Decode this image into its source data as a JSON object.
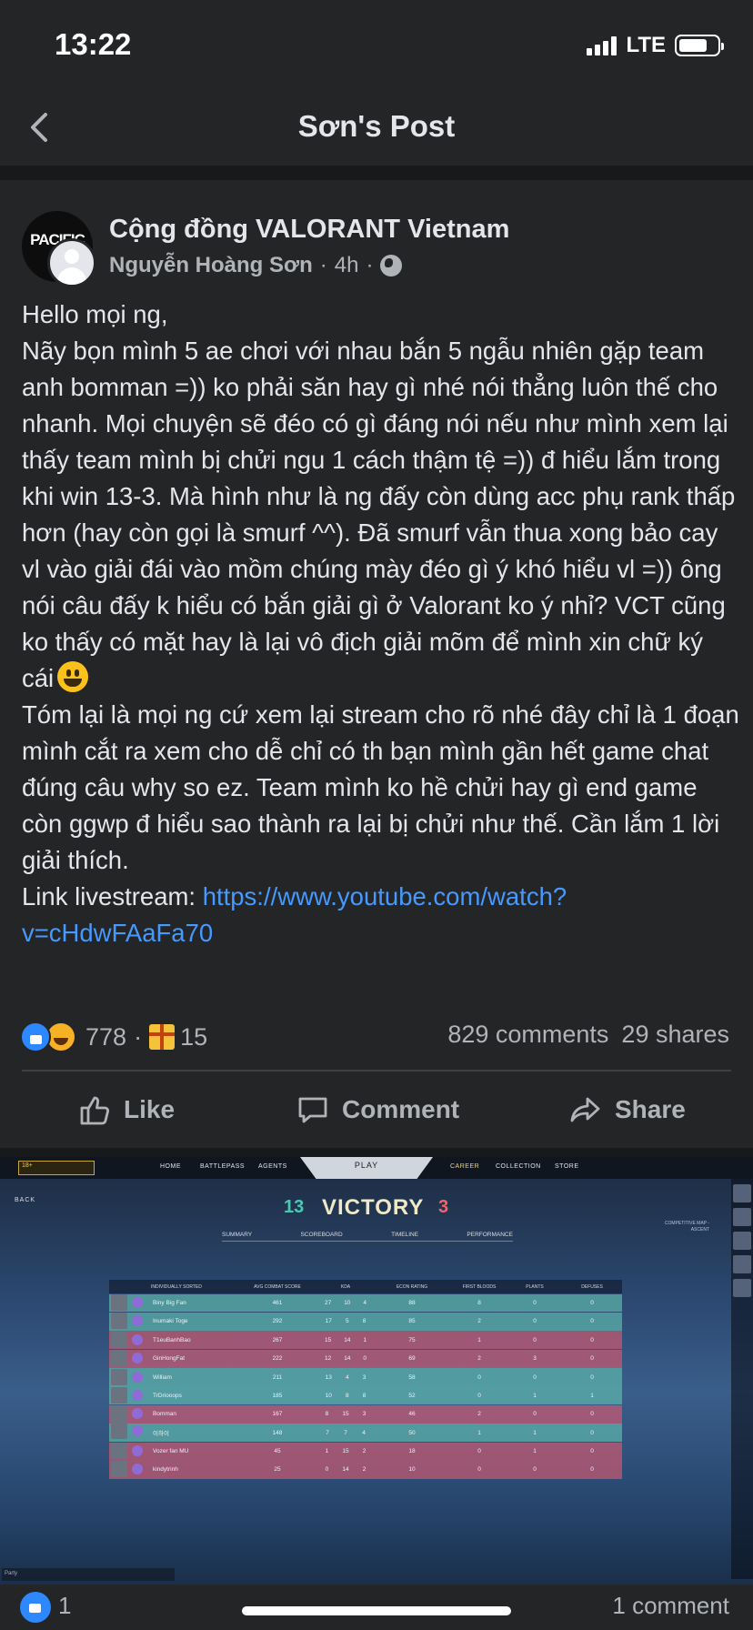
{
  "status_bar": {
    "time": "13:22",
    "network": "LTE"
  },
  "nav": {
    "title": "Sơn's Post"
  },
  "post": {
    "group_name": "Cộng đồng VALORANT Vietnam",
    "group_avatar_text": "PACIFIC",
    "author": "Nguyễn Hoàng Sơn",
    "sep1": "·",
    "time_ago": "4h",
    "sep2": "·",
    "text": {
      "line1": "Hello mọi ng,",
      "para1": "Nãy bọn mình 5 ae chơi với nhau bắn 5 ngẫu nhiên gặp team anh bomman =)) ko phải săn hay gì nhé nói thẳng luôn thế cho nhanh. Mọi chuyện sẽ đéo có gì đáng nói nếu như mình xem lại thấy team mình bị chửi ngu 1 cách thậm tệ =)) đ hiểu lắm trong khi win 13-3. Mà hình như là ng đấy còn dùng acc phụ rank thấp hơn (hay còn gọi là smurf ^^).  Đã smurf vẫn thua xong bảo cay vl vào giải đái vào mồm chúng mày đéo gì ý khó hiểu vl =)) ông nói câu đấy k hiểu có bắn giải gì ở Valorant ko ý nhỉ? VCT cũng ko thấy có mặt hay là lại vô địch giải mõm để mình xin chữ ký cái",
      "para2": "Tóm lại là mọi ng cứ xem lại stream cho rõ nhé đây chỉ là 1 đoạn mình cắt ra xem cho dễ chỉ có th bạn mình gần hết game chat đúng câu why so ez. Team mình ko hề chửi hay gì end game còn ggwp đ hiểu sao thành ra lại bị chửi như thế. Cần lắm 1 lời giải thích.",
      "link_label": "Link livestream: ",
      "link_url": "https://www.youtube.com/watch?v=cHdwFAaFa70"
    },
    "reactions": {
      "count": "778",
      "sep": "·",
      "gifts": "15"
    },
    "comments": "829 comments",
    "shares": "29 shares",
    "actions": {
      "like": "Like",
      "comment": "Comment",
      "share": "Share"
    }
  },
  "game_screenshot": {
    "age_badge": "18+",
    "nav": [
      "HOME",
      "BATTLEPASS",
      "AGENTS",
      "CAREER",
      "COLLECTION",
      "STORE"
    ],
    "play": "PLAY",
    "back": "BACK",
    "score_left": "13",
    "result": "VICTORY",
    "score_right": "3",
    "tabs": [
      "SUMMARY",
      "SCOREBOARD",
      "TIMELINE",
      "PERFORMANCE"
    ],
    "match_info": "COMPETITIVE MAP - ASCENT",
    "table_headers": [
      "INDIVIDUALLY SORTED",
      "AVG COMBAT SCORE",
      "KDA",
      "ECON RATING",
      "FIRST BLOODS",
      "PLANTS",
      "DEFUSES"
    ],
    "rows": [
      {
        "team": "a",
        "name": "Biny Big Fan",
        "acs": "461",
        "k": "27",
        "d": "10",
        "a": "4",
        "econ": "88",
        "fb": "8",
        "plants": "0",
        "defuses": "0"
      },
      {
        "team": "a",
        "name": "Inumaki Toge",
        "acs": "292",
        "k": "17",
        "d": "5",
        "a": "8",
        "econ": "85",
        "fb": "2",
        "plants": "0",
        "defuses": "0"
      },
      {
        "team": "b",
        "name": "T1euBanhBao",
        "acs": "267",
        "k": "15",
        "d": "14",
        "a": "1",
        "econ": "75",
        "fb": "1",
        "plants": "0",
        "defuses": "0"
      },
      {
        "team": "b",
        "name": "GinHongFat",
        "acs": "222",
        "k": "12",
        "d": "14",
        "a": "0",
        "econ": "69",
        "fb": "2",
        "plants": "3",
        "defuses": "0"
      },
      {
        "team": "a",
        "name": "William",
        "acs": "211",
        "k": "13",
        "d": "4",
        "a": "3",
        "econ": "58",
        "fb": "0",
        "plants": "0",
        "defuses": "0"
      },
      {
        "team": "a",
        "name": "TrDriooops",
        "acs": "185",
        "k": "10",
        "d": "8",
        "a": "8",
        "econ": "52",
        "fb": "0",
        "plants": "1",
        "defuses": "1"
      },
      {
        "team": "b",
        "name": "Bomman",
        "acs": "167",
        "k": "8",
        "d": "15",
        "a": "3",
        "econ": "46",
        "fb": "2",
        "plants": "0",
        "defuses": "0"
      },
      {
        "team": "a",
        "name": "이하이",
        "acs": "148",
        "k": "7",
        "d": "7",
        "a": "4",
        "econ": "50",
        "fb": "1",
        "plants": "1",
        "defuses": "0"
      },
      {
        "team": "b",
        "name": "Vozer fan MU",
        "acs": "45",
        "k": "1",
        "d": "15",
        "a": "2",
        "econ": "18",
        "fb": "0",
        "plants": "1",
        "defuses": "0"
      },
      {
        "team": "b",
        "name": "kindytrinh",
        "acs": "25",
        "k": "0",
        "d": "14",
        "a": "2",
        "econ": "10",
        "fb": "0",
        "plants": "0",
        "defuses": "0"
      }
    ],
    "party": "Party"
  },
  "bottom": {
    "reaction_count": "1",
    "comments": "1 comment"
  },
  "colors": {
    "background": "#242526",
    "text": "#e4e6eb",
    "secondary_text": "#b0b3b8",
    "link": "#4599ff",
    "like_blue": "#2d88ff"
  }
}
